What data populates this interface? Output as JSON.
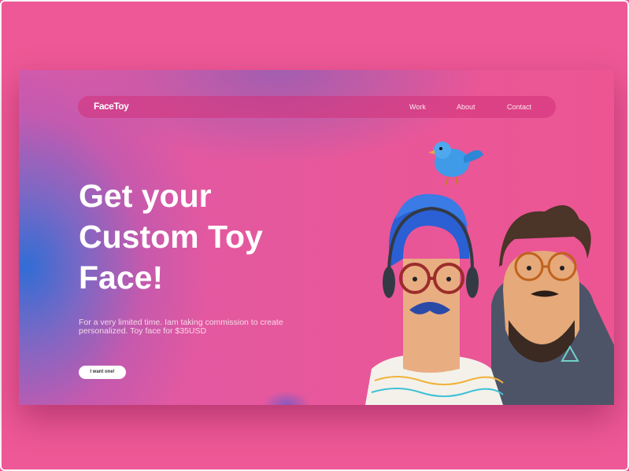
{
  "site": {
    "logo": "FaceToy"
  },
  "nav": {
    "items": [
      {
        "label": "Work"
      },
      {
        "label": "About"
      },
      {
        "label": "Contact"
      }
    ]
  },
  "hero": {
    "headline_lines": [
      "Get your",
      "Custom Toy",
      "Face!"
    ],
    "subtext": "For a very limited time. Iam taking commission to create personalized. Toy face for $35USD",
    "cta_label": "I want one!"
  },
  "colors": {
    "background": "#ee5896",
    "accent_blue": "#2e6fd6",
    "button_bg": "#ffffff"
  },
  "illustration": {
    "characters": [
      "blue-haired toy character with bird",
      "bearded toy character with glasses"
    ]
  }
}
